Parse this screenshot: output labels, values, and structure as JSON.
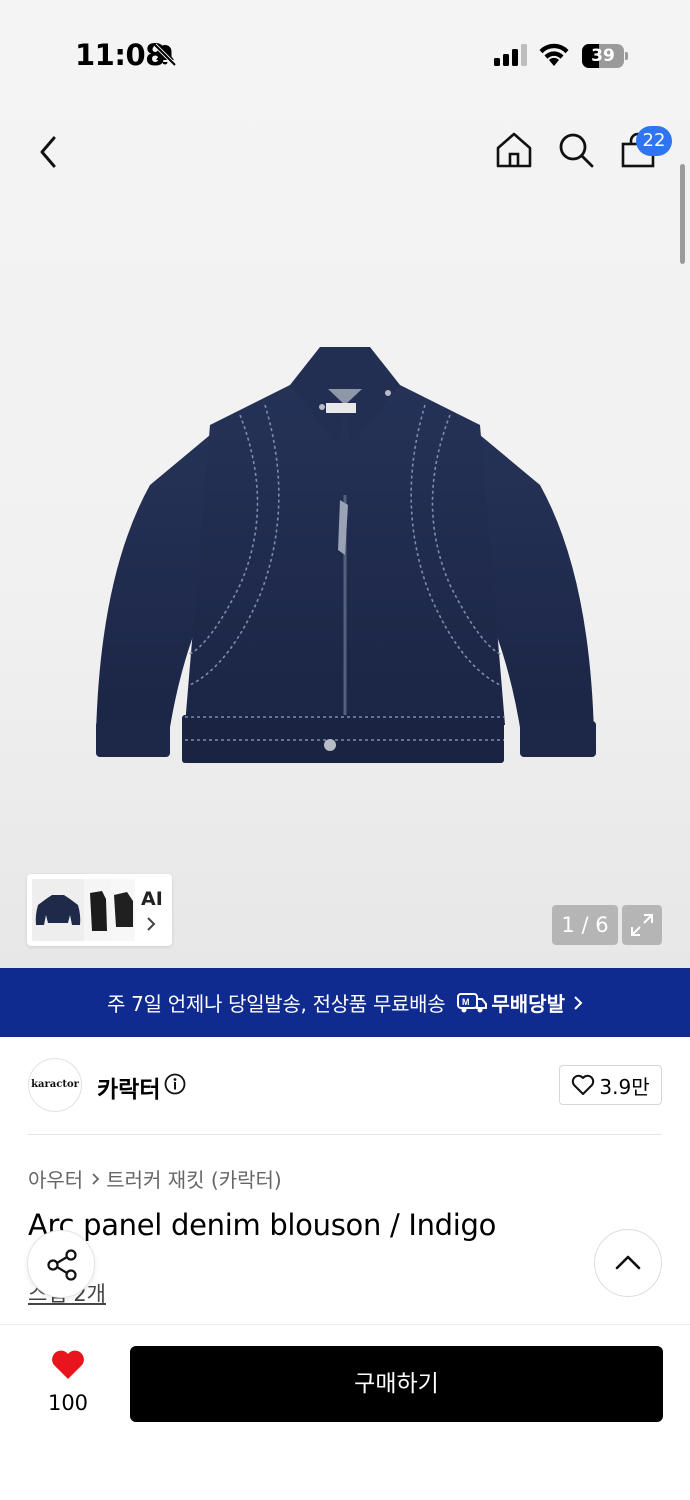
{
  "status_bar": {
    "time": "11:08",
    "battery": "39"
  },
  "header": {
    "cart_count": "22"
  },
  "gallery": {
    "ai_label": "AI",
    "pager": "1 / 6"
  },
  "banner": {
    "tagline": "주 7일 언제나 당일발송, 전상품 무료배송",
    "service_name": "무배당발"
  },
  "brand": {
    "logo_text": "karactor",
    "name": "카락터",
    "like_count": "3.9만"
  },
  "product": {
    "breadcrumb": [
      "아우터",
      "트러커 재킷 (카락터)"
    ],
    "title": "Arc panel denim blouson / Indigo",
    "review_link": "스냅 2개"
  },
  "bottom": {
    "wish_count": "100",
    "buy_label": "구매하기"
  },
  "colors": {
    "banner_bg": "#0f2b8f",
    "badge_bg": "#2f74f0",
    "heart": "#e8161c",
    "denim": "#1e2a4a"
  }
}
